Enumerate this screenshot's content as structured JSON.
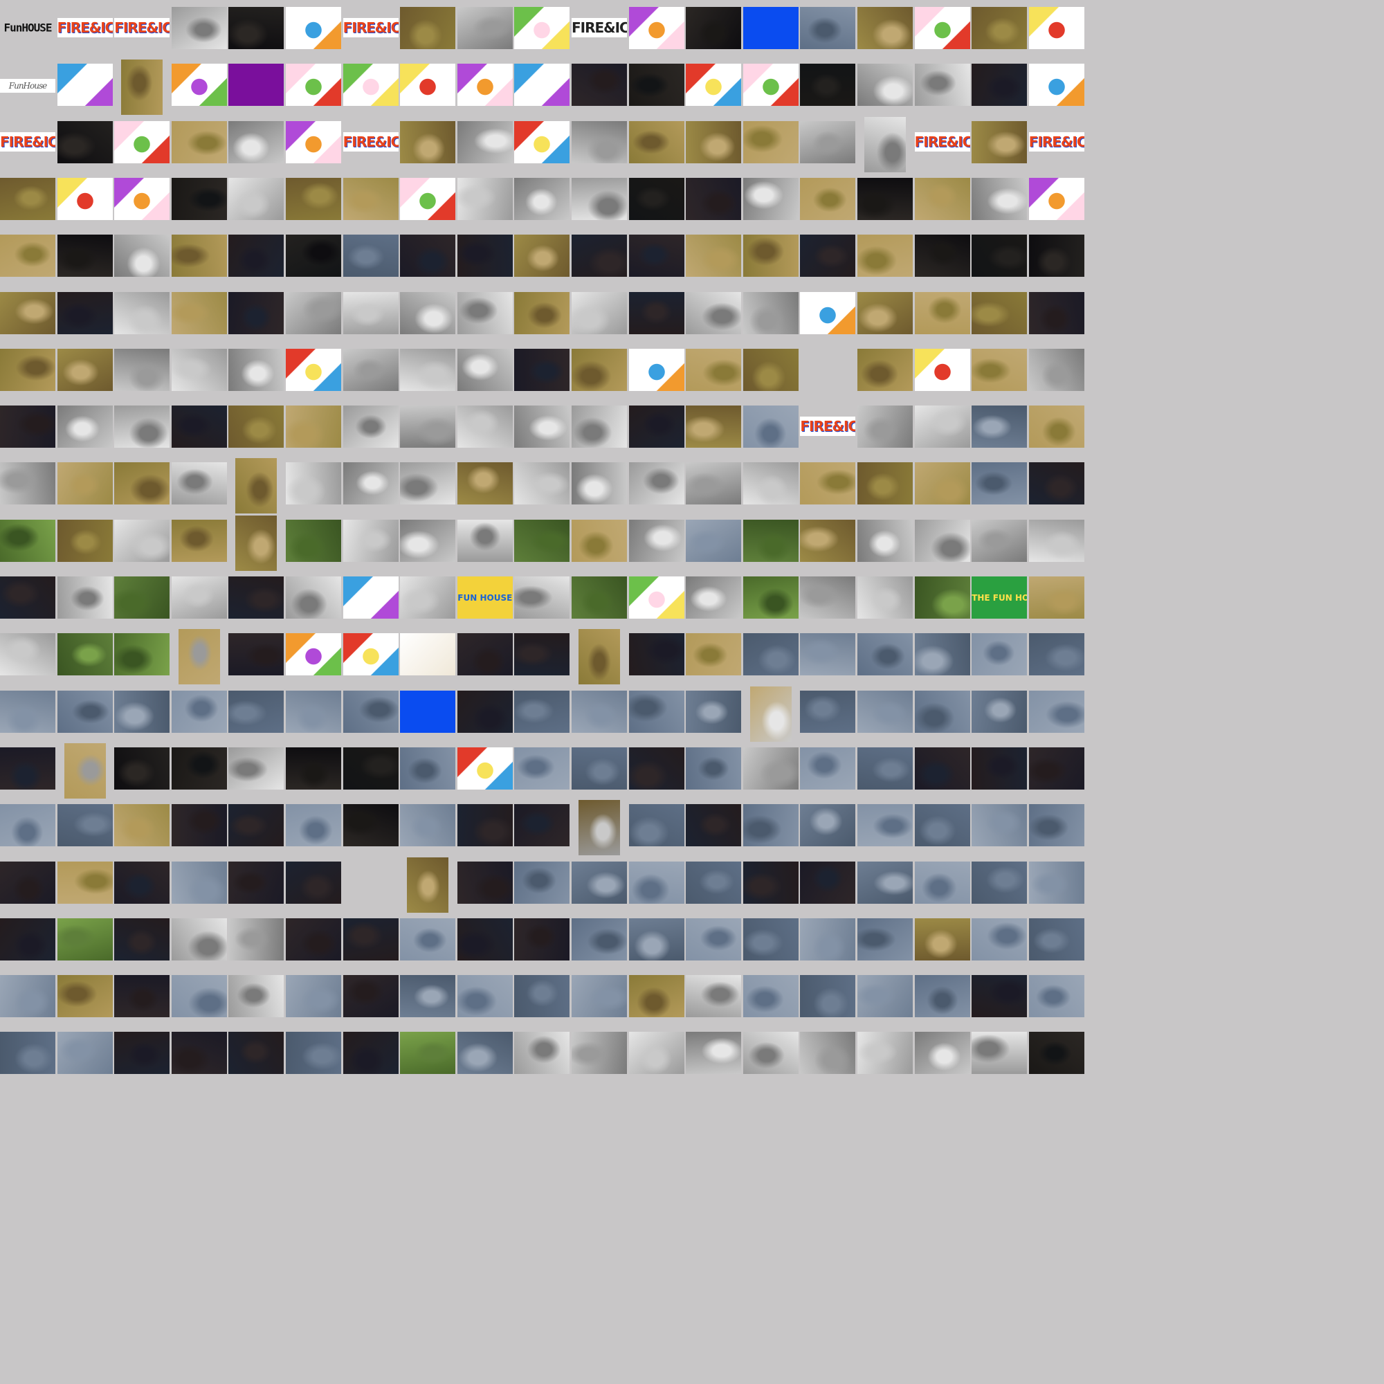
{
  "gallery": {
    "logo_funhouse": "FunHOUSE",
    "logo_funhouse_small": "FunHouse",
    "logo_fire_ice": "FIRE&ICE",
    "banner_fun_house": "FUN HOUSE",
    "banner_the_fun_house": "THE FUN HOUSE"
  },
  "palette": {
    "background": "#c8c6c7",
    "cartoon": [
      "#ffffff",
      "#f7e25a",
      "#e23a2a",
      "#3aa0e0",
      "#6cc04a",
      "#f29a2e",
      "#b04ad8",
      "#ffd6e6"
    ],
    "photo_dark": [
      "#0e0d10",
      "#1a1816",
      "#23211f",
      "#2b2724",
      "#121416"
    ],
    "photo_warm": [
      "#8a7a38",
      "#9c8a46",
      "#b39a5a",
      "#6e5a2e",
      "#c0a872"
    ],
    "photo_gray": [
      "#9a9a9a",
      "#c9c9c9",
      "#e6e6e6",
      "#7a7a7a"
    ],
    "photo_river": [
      "#5e6f86",
      "#6e7e93",
      "#8392a6",
      "#4b5a6d",
      "#9aa6b6"
    ],
    "photo_green": [
      "#4a6a2a",
      "#5e7f3a",
      "#7aa24a",
      "#3a5522"
    ],
    "photo_night": [
      "#1b1a26",
      "#241c1e",
      "#2e2628",
      "#1c2230"
    ]
  }
}
